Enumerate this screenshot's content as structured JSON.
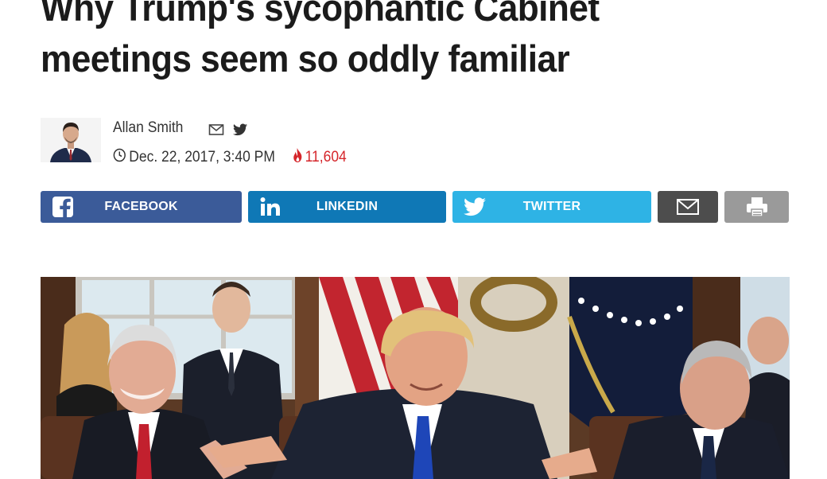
{
  "article": {
    "headline_line1": "Why Trump's sycophantic Cabinet",
    "headline_line2": "meetings seem so oddly familiar"
  },
  "byline": {
    "author": "Allan Smith",
    "date": "Dec. 22, 2017, 3:40 PM",
    "trending_count": "11,604",
    "icons": [
      "email-icon",
      "twitter-icon",
      "clock-icon",
      "flame-icon"
    ]
  },
  "share": {
    "facebook_label": "FACEBOOK",
    "linkedin_label": "LINKEDIN",
    "twitter_label": "TWITTER"
  },
  "colors": {
    "facebook": "#3b5b99",
    "linkedin": "#0f78b6",
    "twitter": "#2eb3e5",
    "email": "#4d4d4d",
    "print": "#9a9a9a",
    "trending": "#d5262b"
  }
}
